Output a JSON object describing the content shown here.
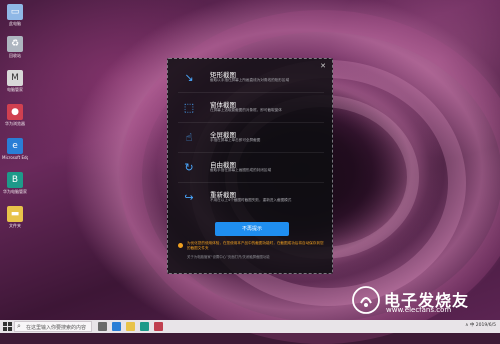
{
  "desktop": {
    "icons": [
      {
        "label": "此电脑",
        "icon": "this-pc-icon",
        "color": "#8fb8e6"
      },
      {
        "label": "回收站",
        "icon": "recycle-bin-icon",
        "color": "#c8d0d8"
      },
      {
        "label": "电脑管家",
        "icon": "pc-manager-icon",
        "color": "#d8d8d8"
      },
      {
        "label": "华为浏览器",
        "icon": "browser-icon",
        "color": "#d04050"
      },
      {
        "label": "Microsoft Edge",
        "icon": "edge-icon",
        "color": "#2a7ed6"
      },
      {
        "label": "华为电脑管家",
        "icon": "huawei-pc-icon",
        "color": "#1e9a8a"
      },
      {
        "label": "文件夹",
        "icon": "folder-icon",
        "color": "#e8c34a"
      }
    ]
  },
  "dialog": {
    "close_label": "✕",
    "options": [
      {
        "title": "矩形截图",
        "desc": "截取以手指在屏幕上所画直线为对角线的矩形区域",
        "icon": "rect-capture-icon"
      },
      {
        "title": "窗体截图",
        "desc": "在屏幕上选取要截图的对象框，即可截取窗体",
        "icon": "window-capture-icon"
      },
      {
        "title": "全屏截图",
        "desc": "手指在屏幕上单击即可全屏截图",
        "icon": "fullscreen-capture-icon"
      },
      {
        "title": "自由截图",
        "desc": "截取手指在屏幕上画圈形成的封闭区域",
        "icon": "free-capture-icon"
      },
      {
        "title": "重新截图",
        "desc": "不用在以上4个截图时截图失败，重新进入截图模式",
        "icon": "recapture-icon"
      }
    ],
    "primary_button": "不再提示",
    "warning": "为优化您的使用体验，在您使用本产品中的截图功能时，在截图成功后将自动保存到您的截图文件夹",
    "footnote": "关于为电脑管家“设置中心”页面打开/关闭触屏截图功能"
  },
  "watermark": {
    "title": "电子发烧友",
    "url": "www.elecfans.com"
  },
  "taskbar": {
    "search_placeholder": "在这里输入你要搜索的内容",
    "tray_text": "∧ 中 2019/6/5"
  },
  "colors": {
    "accent": "#1f8ef0",
    "warning": "#f0a020",
    "panel_bg": "#0e0e12"
  }
}
